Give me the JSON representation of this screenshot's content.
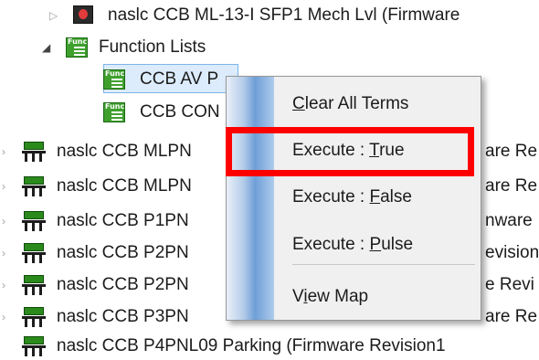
{
  "tree": {
    "top_item": "naslc CCB ML-13-I SFP1 Mech Lvl (Firmware",
    "function_lists": "Function Lists",
    "func_item_1": "CCB AV P",
    "func_item_2": "CCB CON",
    "devices": [
      {
        "label": "naslc CCB MLPN",
        "suffix": "are Re"
      },
      {
        "label": "naslc CCB MLPN",
        "suffix": "are Re"
      },
      {
        "label": "naslc CCB P1PN",
        "suffix": "nware"
      },
      {
        "label": "naslc CCB P2PN",
        "suffix": "evision"
      },
      {
        "label": "naslc CCB P2PN",
        "suffix": "e Revi"
      },
      {
        "label": "naslc CCB P3PN",
        "suffix": "are Re"
      }
    ],
    "bottom_item": "naslc CCB P4PNL09 Parking (Firmware Revision1"
  },
  "context_menu": {
    "clear_all": {
      "pre": "",
      "key": "C",
      "post": "lear All Terms"
    },
    "execute_true": {
      "pre": "Execute : ",
      "key": "T",
      "post": "rue"
    },
    "execute_false": {
      "pre": "Execute : ",
      "key": "F",
      "post": "alse"
    },
    "execute_pulse": {
      "pre": "Execute : ",
      "key": "P",
      "post": "ulse"
    },
    "view_map": {
      "pre": "V",
      "key": "i",
      "post": "ew Map"
    }
  },
  "colors": {
    "highlight": "#ff0000",
    "selection": "#dcecfc",
    "icon_green": "#3fa02e"
  },
  "icons": {
    "function_list": "function-list-icon",
    "device": "device-icon",
    "status": "status-icon"
  }
}
